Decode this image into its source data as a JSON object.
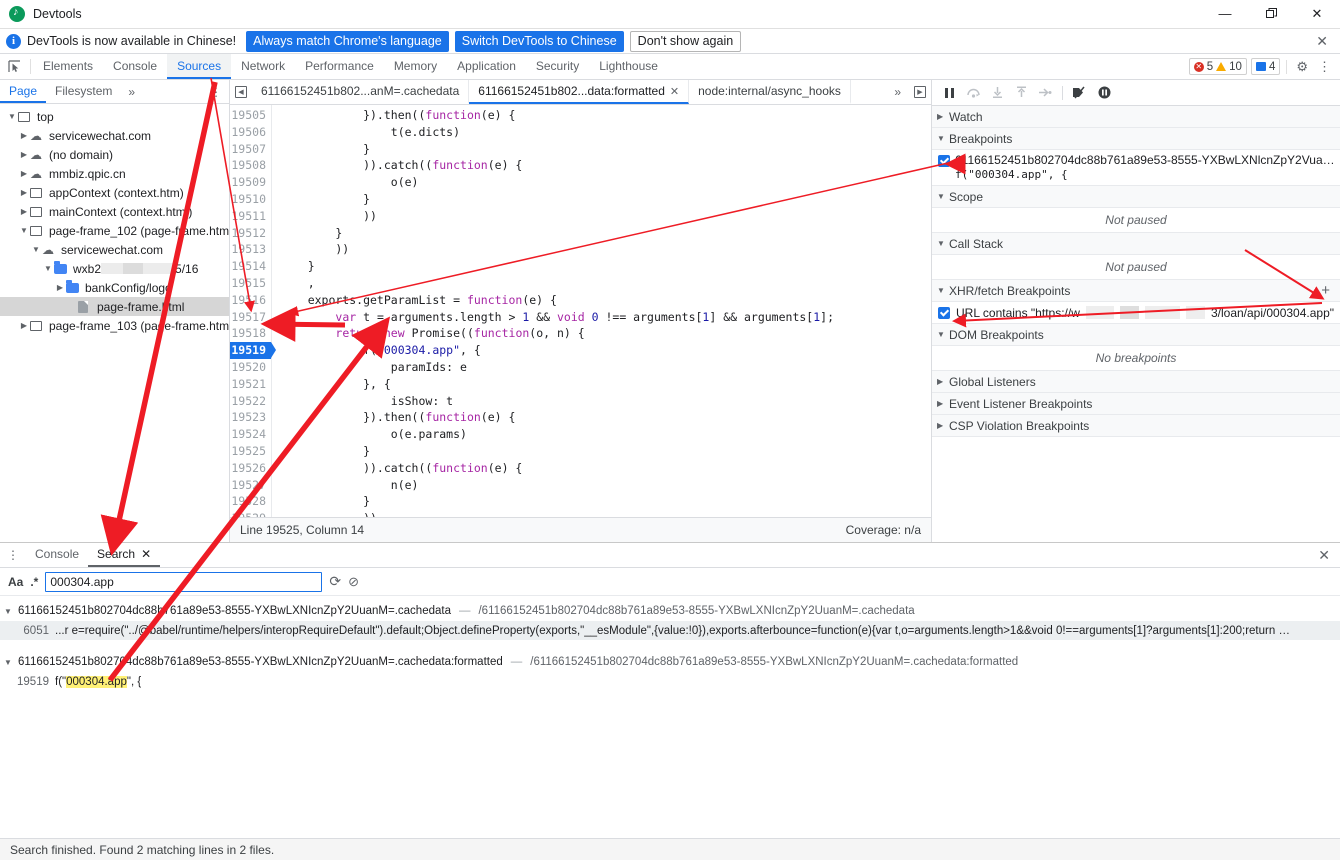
{
  "window": {
    "title": "Devtools",
    "minimize": "—",
    "maximize": "❐",
    "close": "✕"
  },
  "banner": {
    "info_icon": "i",
    "message": "DevTools is now available in Chinese!",
    "primary_button": "Always match Chrome's language",
    "secondary_button": "Switch DevTools to Chinese",
    "dismiss_button": "Don't show again",
    "close_icon": "✕"
  },
  "main_tabs": {
    "inspect_icon": "inspect-icon",
    "items": [
      {
        "label": "Elements",
        "active": false
      },
      {
        "label": "Console",
        "active": false
      },
      {
        "label": "Sources",
        "active": true
      },
      {
        "label": "Network",
        "active": false
      },
      {
        "label": "Performance",
        "active": false
      },
      {
        "label": "Memory",
        "active": false
      },
      {
        "label": "Application",
        "active": false
      },
      {
        "label": "Security",
        "active": false
      },
      {
        "label": "Lighthouse",
        "active": false
      }
    ],
    "errors_count": "5",
    "warnings_count": "10",
    "messages_count": "4",
    "settings_icon": "⚙",
    "more_icon": "⋮"
  },
  "navigator": {
    "tabs": [
      {
        "label": "Page",
        "active": true
      },
      {
        "label": "Filesystem",
        "active": false
      }
    ],
    "more_icon": "»",
    "kebab_icon": "⋮",
    "tree": [
      {
        "indent": 0,
        "twisty": "▼",
        "icon": "frame",
        "label": "top"
      },
      {
        "indent": 1,
        "twisty": "▶",
        "icon": "cloud",
        "label": "servicewechat.com"
      },
      {
        "indent": 1,
        "twisty": "▶",
        "icon": "cloud",
        "label": "(no domain)"
      },
      {
        "indent": 1,
        "twisty": "▶",
        "icon": "cloud",
        "label": "mmbiz.qpic.cn"
      },
      {
        "indent": 1,
        "twisty": "▶",
        "icon": "frame",
        "label": "appContext (context.htm)"
      },
      {
        "indent": 1,
        "twisty": "▶",
        "icon": "frame",
        "label": "mainContext (context.html)"
      },
      {
        "indent": 1,
        "twisty": "▼",
        "icon": "frame",
        "label": "page-frame_102 (page-frame.htm"
      },
      {
        "indent": 2,
        "twisty": "▼",
        "icon": "cloud",
        "label": "servicewechat.com"
      },
      {
        "indent": 3,
        "twisty": "▼",
        "icon": "folder",
        "label": "wxb2",
        "redacted": true,
        "suffix": "5/16"
      },
      {
        "indent": 4,
        "twisty": "▶",
        "icon": "folder",
        "label": "bankConfig/logo"
      },
      {
        "indent": 5,
        "twisty": "",
        "icon": "file",
        "label": "page-frame.html",
        "selected": true
      },
      {
        "indent": 1,
        "twisty": "▶",
        "icon": "frame",
        "label": "page-frame_103 (page-frame.htm"
      }
    ]
  },
  "editor": {
    "nav_back_icon": "◀",
    "tabs": [
      {
        "label": "61166152451b802...anM=.cachedata",
        "active": false,
        "closable": false
      },
      {
        "label": "61166152451b802...data:formatted",
        "active": true,
        "closable": true
      },
      {
        "label": "node:internal/async_hooks",
        "active": false,
        "closable": false
      }
    ],
    "close_icon": "✕",
    "overflow_icon": "»",
    "popout_icon": "▶",
    "first_line_number": 19505,
    "current_line": 19519,
    "lines": [
      "            }).then((function(e) {",
      "                t(e.dicts)",
      "            }",
      "            )).catch((function(e) {",
      "                o(e)",
      "            }",
      "            ))",
      "        }",
      "        ))",
      "    }",
      "    ,",
      "    exports.getParamList = function(e) {",
      "        var t = arguments.length > 1 && void 0 !== arguments[1] && arguments[1];",
      "        return new Promise((function(o, n) {",
      "            f(\"000304.app\", {",
      "                paramIds: e",
      "            }, {",
      "                isShow: t",
      "            }).then((function(e) {",
      "                o(e.params)",
      "            }",
      "            )).catch((function(e) {",
      "                n(e)",
      "            }",
      "            ))",
      "        }",
      "        ))",
      "    }",
      "    ,",
      "",
      ""
    ],
    "status_line": "Line 19525, Column 14",
    "coverage": "Coverage: n/a"
  },
  "debugger": {
    "toolbar": [
      {
        "name": "resume-button",
        "glyph": "❚❚"
      },
      {
        "name": "step-over-button",
        "glyph": "⤴"
      },
      {
        "name": "step-into-button",
        "glyph": "↓"
      },
      {
        "name": "step-out-button",
        "glyph": "↑"
      },
      {
        "name": "step-button",
        "glyph": "⇥"
      },
      {
        "name": "deactivate-breakpoints-button",
        "glyph": "⊘"
      },
      {
        "name": "pause-on-exceptions-button",
        "glyph": "⏸"
      }
    ],
    "sections": {
      "watch": {
        "label": "Watch",
        "expanded": false,
        "twisty": "▶"
      },
      "breakpoints": {
        "label": "Breakpoints",
        "expanded": true,
        "twisty": "▼"
      },
      "scope": {
        "label": "Scope",
        "expanded": true,
        "twisty": "▼",
        "empty": "Not paused"
      },
      "call_stack": {
        "label": "Call Stack",
        "expanded": true,
        "twisty": "▼",
        "empty": "Not paused"
      },
      "xhr": {
        "label": "XHR/fetch Breakpoints",
        "expanded": true,
        "twisty": "▼",
        "add_icon": "+"
      },
      "dom": {
        "label": "DOM Breakpoints",
        "expanded": true,
        "twisty": "▼",
        "empty": "No breakpoints"
      },
      "global_listeners": {
        "label": "Global Listeners",
        "expanded": false,
        "twisty": "▶"
      },
      "event_listener": {
        "label": "Event Listener Breakpoints",
        "expanded": false,
        "twisty": "▶"
      },
      "csp": {
        "label": "CSP Violation Breakpoints",
        "expanded": false,
        "twisty": "▶"
      }
    },
    "breakpoint_item": {
      "checked": true,
      "location": "61166152451b802704dc88b761a89e53-8555-YXBwLXNIcnZpY2UuanM=.cachedata:formatted",
      "location_display": "61166152451b802704dc88b761a89e53-8555-YXBwLXNlcnZpY2VuanM…",
      "code": "f(\"000304.app\", {"
    },
    "xhr_breakpoint": {
      "checked": true,
      "prefix": "URL contains \"https://w",
      "suffix": "3/loan/api/000304.app\""
    }
  },
  "drawer": {
    "kebab_icon": "⋮",
    "tabs": [
      {
        "label": "Console",
        "active": false,
        "closable": false
      },
      {
        "label": "Search",
        "active": true,
        "closable": true
      }
    ],
    "tab_close_icon": "✕",
    "close_icon": "✕",
    "search": {
      "match_case_icon": "Aa",
      "regex_icon": ".*",
      "value": "000304.app",
      "placeholder": "",
      "refresh_icon": "⟳",
      "clear_icon": "⊘"
    },
    "results": [
      {
        "twisty": "▼",
        "name": "61166152451b802704dc88b761a89e53-8555-YXBwLXNIcnZpY2UuanM=.cachedata",
        "dash": "—",
        "url": "/61166152451b802704dc88b761a89e53-8555-YXBwLXNIcnZpY2UuanM=.cachedata",
        "line_number": "6051",
        "snippet_pre": "...r e=require(\"../@babel/runtime/helpers/interopRequireDefault\").default;Object.defineProperty(exports,\"__esModule\",{value:!0}),exports.afterbounce=function(e){var t,o=arguments.length>1&&void 0!==arguments[1]?arguments[1]:200;return ",
        "snippet_ellipsis": "…",
        "highlighted": false
      },
      {
        "twisty": "▼",
        "name": "61166152451b802704dc88b761a89e53-8555-YXBwLXNIcnZpY2UuanM=.cachedata:formatted",
        "dash": "—",
        "url": "/61166152451b802704dc88b761a89e53-8555-YXBwLXNIcnZpY2UuanM=.cachedata:formatted",
        "line_number": "19519",
        "snippet_pre": "f(\"",
        "snippet_highlight": "000304.app",
        "snippet_post": "\", {",
        "highlighted": true
      }
    ]
  },
  "status_bar": {
    "text": "Search finished.  Found 2 matching lines in 2 files."
  },
  "annotations": {
    "arrow_color": "#ee1c25",
    "count": 5
  }
}
